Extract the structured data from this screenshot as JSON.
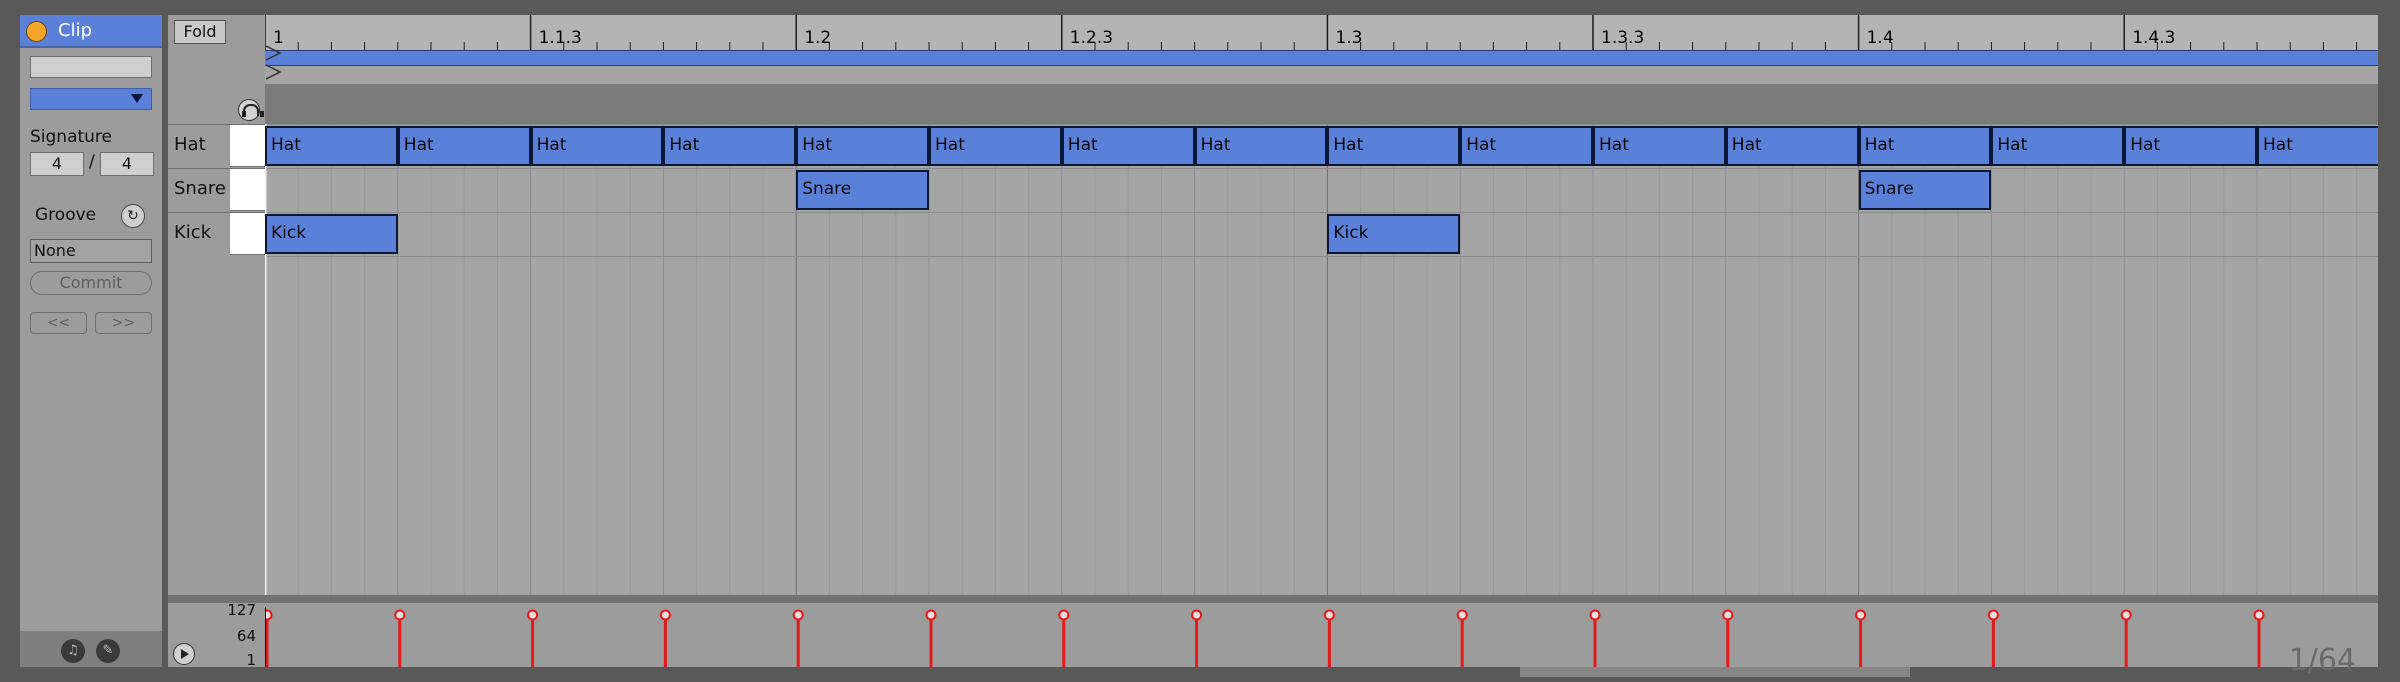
{
  "clip": {
    "title": "Clip",
    "name_value": "",
    "signature_label": "Signature",
    "sig_numerator": "4",
    "sig_slash": "/",
    "sig_denominator": "4",
    "groove_label": "Groove",
    "groove_value": "None",
    "commit_label": "Commit",
    "prev_label": "<<",
    "next_label": ">>",
    "icons": [
      "note-icon",
      "pencil-icon",
      "groove-hotswap-icon"
    ]
  },
  "editor": {
    "fold_label": "Fold",
    "ruler_labels": [
      "1",
      "1.1.3",
      "1.2",
      "1.2.3",
      "1.3",
      "1.3.3",
      "1.4",
      "1.4.3"
    ],
    "rows": [
      {
        "label": "Hat"
      },
      {
        "label": "Snare"
      },
      {
        "label": "Kick"
      }
    ],
    "notes": [
      {
        "row": 0,
        "label": "Hat",
        "step": 0,
        "length": 1
      },
      {
        "row": 0,
        "label": "Hat",
        "step": 1,
        "length": 1
      },
      {
        "row": 0,
        "label": "Hat",
        "step": 2,
        "length": 1
      },
      {
        "row": 0,
        "label": "Hat",
        "step": 3,
        "length": 1
      },
      {
        "row": 0,
        "label": "Hat",
        "step": 4,
        "length": 1
      },
      {
        "row": 0,
        "label": "Hat",
        "step": 5,
        "length": 1
      },
      {
        "row": 0,
        "label": "Hat",
        "step": 6,
        "length": 1
      },
      {
        "row": 0,
        "label": "Hat",
        "step": 7,
        "length": 1
      },
      {
        "row": 0,
        "label": "Hat",
        "step": 8,
        "length": 1
      },
      {
        "row": 0,
        "label": "Hat",
        "step": 9,
        "length": 1
      },
      {
        "row": 0,
        "label": "Hat",
        "step": 10,
        "length": 1
      },
      {
        "row": 0,
        "label": "Hat",
        "step": 11,
        "length": 1
      },
      {
        "row": 0,
        "label": "Hat",
        "step": 12,
        "length": 1
      },
      {
        "row": 0,
        "label": "Hat",
        "step": 13,
        "length": 1
      },
      {
        "row": 0,
        "label": "Hat",
        "step": 14,
        "length": 1
      },
      {
        "row": 0,
        "label": "Hat",
        "step": 15,
        "length": 1
      },
      {
        "row": 1,
        "label": "Snare",
        "step": 4,
        "length": 1
      },
      {
        "row": 1,
        "label": "Snare",
        "step": 12,
        "length": 1
      },
      {
        "row": 2,
        "label": "Kick",
        "step": 0,
        "length": 1
      },
      {
        "row": 2,
        "label": "Kick",
        "step": 8,
        "length": 1
      }
    ],
    "velocity_scale": [
      "127",
      "64",
      "1"
    ],
    "velocities": [
      127,
      127,
      127,
      127,
      127,
      127,
      127,
      127,
      127,
      127,
      127,
      127,
      127,
      127,
      127,
      127
    ],
    "page_indicator": "1/64"
  },
  "colors": {
    "note_fill": "#5b80d8",
    "velocity_stem": "#e41a1a",
    "clip_dot": "#f4a52a"
  }
}
